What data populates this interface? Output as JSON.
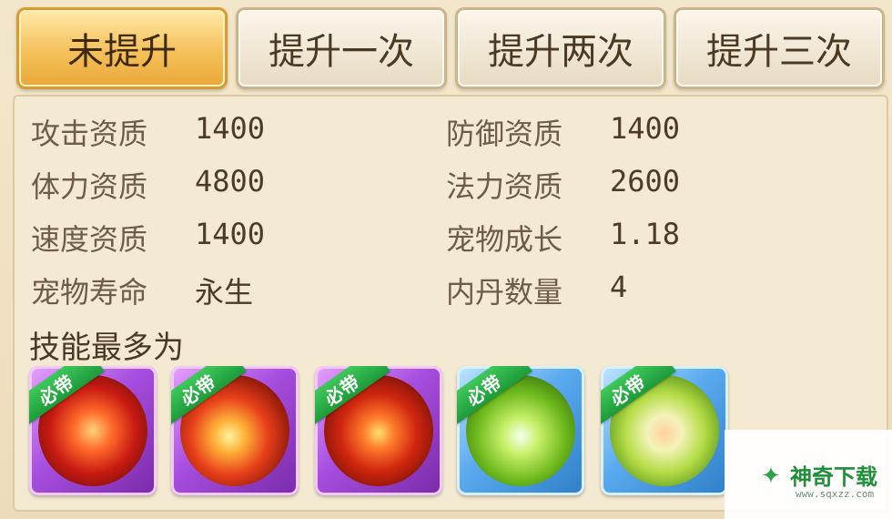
{
  "tabs": [
    {
      "label": "未提升",
      "active": true
    },
    {
      "label": "提升一次",
      "active": false
    },
    {
      "label": "提升两次",
      "active": false
    },
    {
      "label": "提升三次",
      "active": false
    }
  ],
  "stats": {
    "attack": {
      "label": "攻击资质",
      "value": "1400"
    },
    "defense": {
      "label": "防御资质",
      "value": "1400"
    },
    "stamina": {
      "label": "体力资质",
      "value": "4800"
    },
    "magic": {
      "label": "法力资质",
      "value": "2600"
    },
    "speed": {
      "label": "速度资质",
      "value": "1400"
    },
    "growth": {
      "label": "宠物成长",
      "value": "1.18"
    },
    "lifespan": {
      "label": "宠物寿命",
      "value": "永生"
    },
    "inner_pills": {
      "label": "内丹数量",
      "value": "4"
    }
  },
  "skills": {
    "title": "技能最多为",
    "badge_label": "必带",
    "items": [
      {
        "icon": "fire-skill-icon",
        "frame": "purple"
      },
      {
        "icon": "fireball-skill-icon",
        "frame": "purple"
      },
      {
        "icon": "flame-burst-skill-icon",
        "frame": "purple"
      },
      {
        "icon": "rabbit-spirit-skill-icon",
        "frame": "blue"
      },
      {
        "icon": "flame-orb-skill-icon",
        "frame": "blue"
      }
    ]
  },
  "watermark": {
    "title": "神奇下载",
    "url": "www.sqxzz.com"
  },
  "colors": {
    "tab_active": "#f4c059",
    "tab_inactive": "#e7dac0",
    "badge_green": "#1d9a3a",
    "frame_purple": "#a64ee0",
    "frame_blue": "#5aaaf0"
  }
}
